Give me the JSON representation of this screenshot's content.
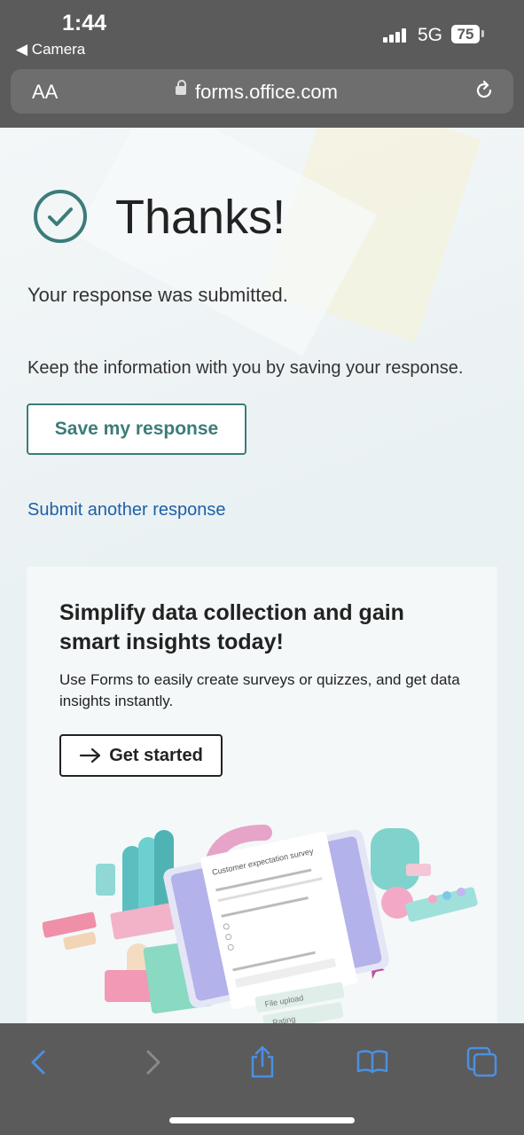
{
  "status": {
    "time": "1:44",
    "back_app": "◀ Camera",
    "network": "5G",
    "battery": "75"
  },
  "browser": {
    "text_size": "AA",
    "url": "forms.office.com"
  },
  "confirmation": {
    "title": "Thanks!",
    "submitted_text": "Your response was submitted.",
    "keep_text": "Keep the information with you by saving your response.",
    "save_label": "Save my response",
    "another_label": "Submit another response"
  },
  "promo": {
    "title": "Simplify data collection and gain smart insights today!",
    "description": "Use Forms to easily create surveys or quizzes, and get data insights instantly.",
    "cta_label": "Get started",
    "illustration": {
      "survey_title": "Customer expectation survey",
      "chip_file_upload": "File upload",
      "chip_rating": "Rating"
    }
  },
  "colors": {
    "accent": "#3c7c7a",
    "link": "#1f5fa8",
    "chrome": "#5b5b5b",
    "toolbar_icon": "#4a90e2"
  }
}
